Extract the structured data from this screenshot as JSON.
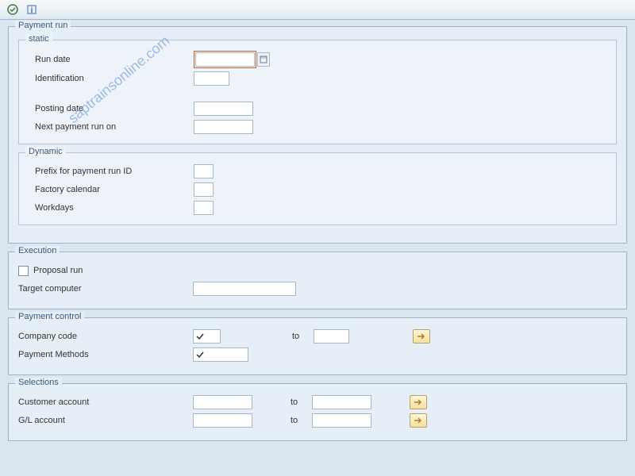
{
  "watermark": "saptrainsonline.com",
  "payment_run": {
    "title": "Payment run",
    "static": {
      "title": "static",
      "run_date_label": "Run date",
      "run_date": "",
      "identification_label": "Identification",
      "identification": "",
      "posting_date_label": "Posting date",
      "posting_date": "",
      "next_payment_label": "Next payment run on",
      "next_payment": ""
    },
    "dynamic": {
      "title": "Dynamic",
      "prefix_label": "Prefix for payment run ID",
      "prefix": "",
      "factory_calendar_label": "Factory calendar",
      "factory_calendar": "",
      "workdays_label": "Workdays",
      "workdays": ""
    }
  },
  "execution": {
    "title": "Execution",
    "proposal_run_label": "Proposal run",
    "proposal_run": false,
    "target_computer_label": "Target computer",
    "target_computer": ""
  },
  "payment_control": {
    "title": "Payment control",
    "company_code_label": "Company code",
    "company_code_from": "",
    "payment_methods_label": "Payment Methods",
    "payment_methods": "",
    "to_label": "to",
    "company_code_to": ""
  },
  "selections": {
    "title": "Selections",
    "customer_account_label": "Customer account",
    "customer_account_from": "",
    "customer_account_to": "",
    "gl_account_label": "G/L account",
    "gl_account_from": "",
    "gl_account_to": "",
    "to_label": "to"
  }
}
